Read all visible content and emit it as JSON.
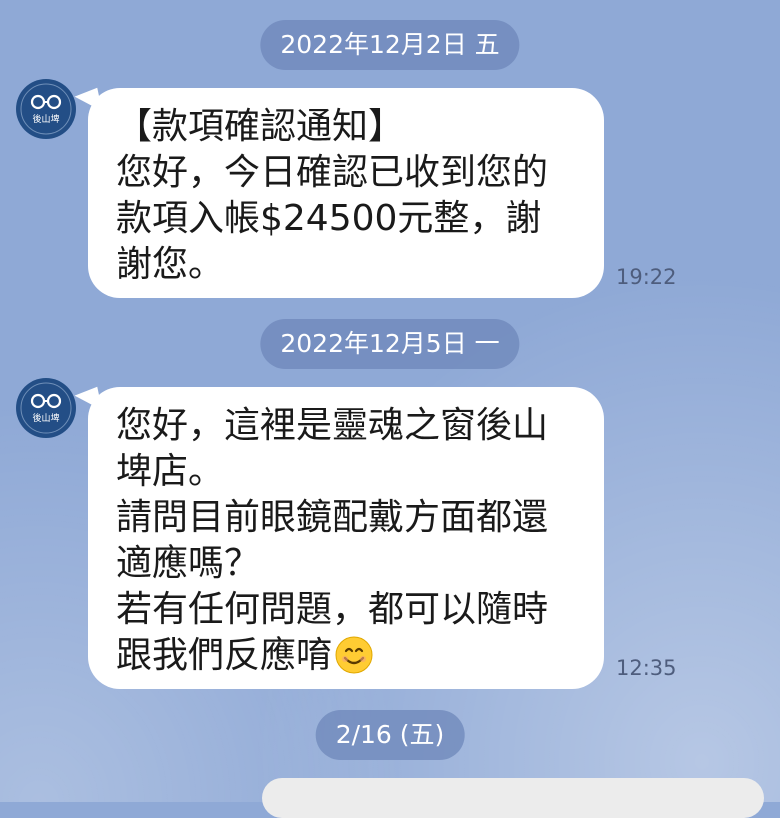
{
  "chat": {
    "date_1": "2022年12月2日 五",
    "date_2": "2022年12月5日 一",
    "date_3": "2/16 (五)",
    "avatar_label": "後山埤",
    "message_1": {
      "text": "【款項確認通知】\n您好，今日確認已收到您的款項入帳$24500元整，謝謝您。",
      "time": "19:22"
    },
    "message_2": {
      "text": "您好，這裡是靈魂之窗後山埤店。\n請問目前眼鏡配戴方面都還適應嗎？\n若有任何問題，都可以隨時跟我們反應唷",
      "emoji": "smiling-face-icon",
      "time": "12:35"
    }
  },
  "colors": {
    "background": "#8fa9d6",
    "bubble": "#ffffff",
    "date_pill": "#6e87b9",
    "avatar": "#234e86"
  }
}
